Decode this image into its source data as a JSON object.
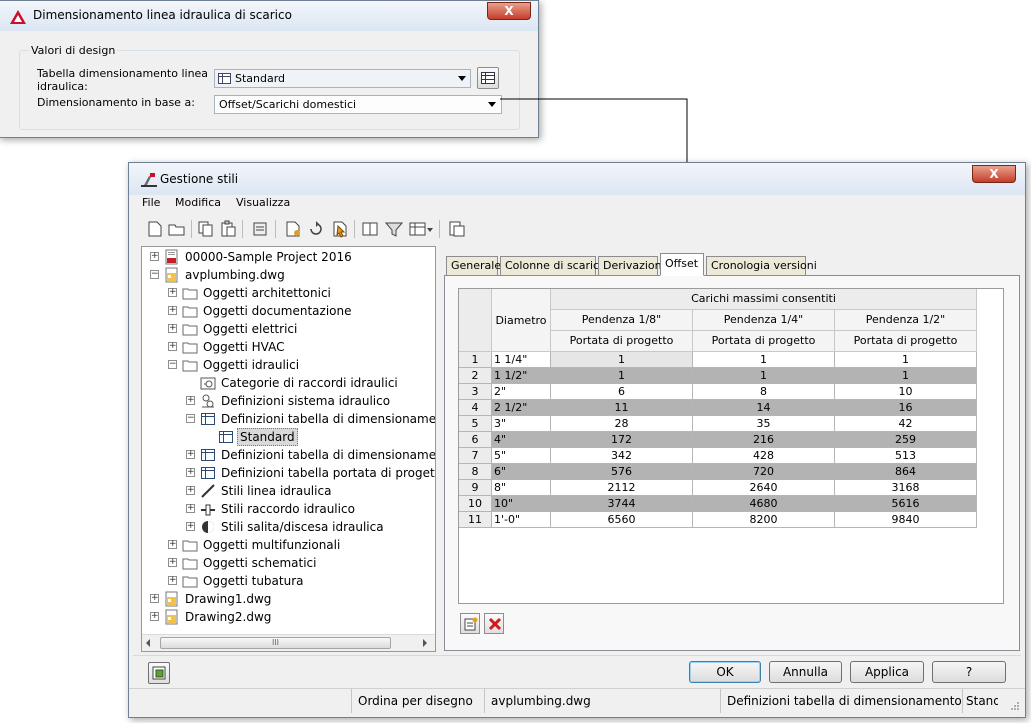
{
  "dialog_top": {
    "title": "Dimensionamento linea idraulica di scarico",
    "close_label": "X",
    "group_title": "Valori di design",
    "table_label_l1": "Tabella dimensionamento linea",
    "table_label_l2": "idraulica:",
    "table_value": "Standard",
    "sizing_label": "Dimensionamento in base a:",
    "sizing_value": "Offset/Scarichi domestici"
  },
  "dialog_main": {
    "title": "Gestione stili",
    "close_label": "X",
    "menu": [
      "File",
      "Modifica",
      "Visualizza"
    ],
    "toolbar_icons": [
      "new-icon",
      "open-icon",
      "copy-icon",
      "paste-icon",
      "purge-icon",
      "edit-icon",
      "set-from-icon",
      "select-icon",
      "compare-icon",
      "filter-icon",
      "view-icon",
      "dropdown-icon",
      "toggle-view-icon"
    ],
    "tree": [
      {
        "label": "00000-Sample Project 2016",
        "depth": 0,
        "icon": "project-icon",
        "exp": "+"
      },
      {
        "label": "avplumbing.dwg",
        "depth": 0,
        "icon": "drawing-icon",
        "exp": "-"
      },
      {
        "label": "Oggetti architettonici",
        "depth": 1,
        "icon": "folder-icon",
        "exp": "+"
      },
      {
        "label": "Oggetti documentazione",
        "depth": 1,
        "icon": "folder-icon",
        "exp": "+"
      },
      {
        "label": "Oggetti elettrici",
        "depth": 1,
        "icon": "folder-icon",
        "exp": "+"
      },
      {
        "label": "Oggetti HVAC",
        "depth": 1,
        "icon": "folder-icon",
        "exp": "+"
      },
      {
        "label": "Oggetti idraulici",
        "depth": 1,
        "icon": "folder-icon",
        "exp": "-"
      },
      {
        "label": "Categorie di raccordi idraulici",
        "depth": 2,
        "icon": "category-icon",
        "exp": ""
      },
      {
        "label": "Definizioni sistema idraulico",
        "depth": 2,
        "icon": "system-icon",
        "exp": "+"
      },
      {
        "label": "Definizioni tabella di dimensionamento",
        "depth": 2,
        "icon": "table-icon",
        "exp": "-"
      },
      {
        "label": "Standard",
        "depth": 3,
        "icon": "table-icon",
        "exp": "",
        "selected": true
      },
      {
        "label": "Definizioni tabella di dimensionamento",
        "depth": 2,
        "icon": "table-icon",
        "exp": "+"
      },
      {
        "label": "Definizioni tabella portata di progetto",
        "depth": 2,
        "icon": "table-icon",
        "exp": "+"
      },
      {
        "label": "Stili linea idraulica",
        "depth": 2,
        "icon": "pipe-icon",
        "exp": "+"
      },
      {
        "label": "Stili raccordo idraulico",
        "depth": 2,
        "icon": "fitting-icon",
        "exp": "+"
      },
      {
        "label": "Stili salita/discesa idraulica",
        "depth": 2,
        "icon": "riser-icon",
        "exp": "+"
      },
      {
        "label": "Oggetti multifunzionali",
        "depth": 1,
        "icon": "folder-icon",
        "exp": "+"
      },
      {
        "label": "Oggetti schematici",
        "depth": 1,
        "icon": "folder-icon",
        "exp": "+"
      },
      {
        "label": "Oggetti tubatura",
        "depth": 1,
        "icon": "folder-icon",
        "exp": "+"
      },
      {
        "label": "Drawing1.dwg",
        "depth": 0,
        "icon": "drawing-icon",
        "exp": "+"
      },
      {
        "label": "Drawing2.dwg",
        "depth": 0,
        "icon": "drawing-icon",
        "exp": "+"
      }
    ],
    "scroll_thumb": "III",
    "tabs": [
      "Generale",
      "Colonne di scarico",
      "Derivazioni",
      "Offset",
      "Cronologia versioni"
    ],
    "active_tab": "Offset",
    "grid": {
      "col_diam": "Diametro",
      "group_header": "Carichi massimi consentiti",
      "slopes": [
        "Pendenza 1/8\"",
        "Pendenza 1/4\"",
        "Pendenza 1/2\""
      ],
      "sub_header": "Portata di progetto",
      "rows": [
        {
          "n": "1",
          "d": "1 1/4\"",
          "v": [
            "1",
            "1",
            "1"
          ]
        },
        {
          "n": "2",
          "d": "1 1/2\"",
          "v": [
            "1",
            "1",
            "1"
          ]
        },
        {
          "n": "3",
          "d": "2\"",
          "v": [
            "6",
            "8",
            "10"
          ]
        },
        {
          "n": "4",
          "d": "2 1/2\"",
          "v": [
            "11",
            "14",
            "16"
          ]
        },
        {
          "n": "5",
          "d": "3\"",
          "v": [
            "28",
            "35",
            "42"
          ]
        },
        {
          "n": "6",
          "d": "4\"",
          "v": [
            "172",
            "216",
            "259"
          ]
        },
        {
          "n": "7",
          "d": "5\"",
          "v": [
            "342",
            "428",
            "513"
          ]
        },
        {
          "n": "8",
          "d": "6\"",
          "v": [
            "576",
            "720",
            "864"
          ]
        },
        {
          "n": "9",
          "d": "8\"",
          "v": [
            "2112",
            "2640",
            "3168"
          ]
        },
        {
          "n": "10",
          "d": "10\"",
          "v": [
            "3744",
            "4680",
            "5616"
          ]
        },
        {
          "n": "11",
          "d": "1'-0\"",
          "v": [
            "6560",
            "8200",
            "9840"
          ]
        }
      ]
    },
    "ok": "OK",
    "cancel": "Annulla",
    "apply": "Applica",
    "help": "?",
    "status": [
      "Ordina per disegno",
      "avplumbing.dwg",
      "Definizioni tabella di dimensionamento dei t",
      "Standa"
    ]
  }
}
